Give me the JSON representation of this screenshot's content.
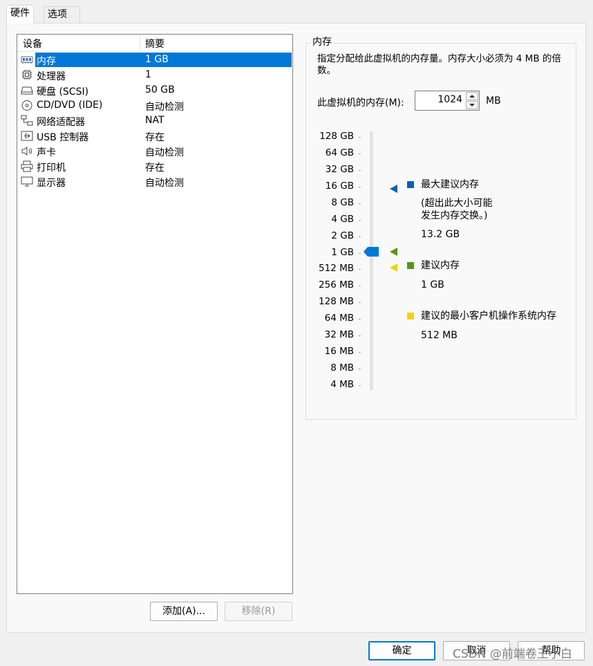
{
  "tabs": [
    "硬件",
    "选项"
  ],
  "device_list": {
    "col_device": "设备",
    "col_summary": "摘要",
    "rows": [
      {
        "icon": "memory-icon",
        "name": "内存",
        "summary": "1 GB"
      },
      {
        "icon": "processor-icon",
        "name": "处理器",
        "summary": "1"
      },
      {
        "icon": "harddisk-icon",
        "name": "硬盘 (SCSI)",
        "summary": "50 GB"
      },
      {
        "icon": "cd-dvd-icon",
        "name": "CD/DVD (IDE)",
        "summary": "自动检测"
      },
      {
        "icon": "network-adapter-icon",
        "name": "网络适配器",
        "summary": "NAT"
      },
      {
        "icon": "usb-icon",
        "name": "USB 控制器",
        "summary": "存在"
      },
      {
        "icon": "sound-card-icon",
        "name": "声卡",
        "summary": "自动检测"
      },
      {
        "icon": "printer-icon",
        "name": "打印机",
        "summary": "存在"
      },
      {
        "icon": "display-icon",
        "name": "显示器",
        "summary": "自动检测"
      }
    ]
  },
  "buttons": {
    "add": "添加(A)...",
    "remove": "移除(R)",
    "ok": "确定",
    "cancel": "取消",
    "help": "帮助"
  },
  "memory": {
    "group_title": "内存",
    "description": "指定分配给此虚拟机的内存量。内存大小必须为 4 MB 的倍数。",
    "field_label": "此虚拟机的内存(M):",
    "value": "1024",
    "unit": "MB",
    "scale": [
      "128 GB",
      "64 GB",
      "32 GB",
      "16 GB",
      "8 GB",
      "4 GB",
      "2 GB",
      "1 GB",
      "512 MB",
      "256 MB",
      "128 MB",
      "64 MB",
      "32 MB",
      "16 MB",
      "8 MB",
      "4 MB"
    ],
    "max_recommended": {
      "label": "最大建议内存",
      "note_line1": "(超出此大小可能",
      "note_line2": "发生内存交换。)",
      "value": "13.2 GB",
      "color": "#0063b1"
    },
    "recommended": {
      "label": "建议内存",
      "value": "1 GB",
      "color": "#4f9a13"
    },
    "guest_min": {
      "label": "建议的最小客户机操作系统内存",
      "value": "512 MB",
      "color": "#f5d300"
    }
  },
  "watermark": "CSDN @前端卷王小白"
}
